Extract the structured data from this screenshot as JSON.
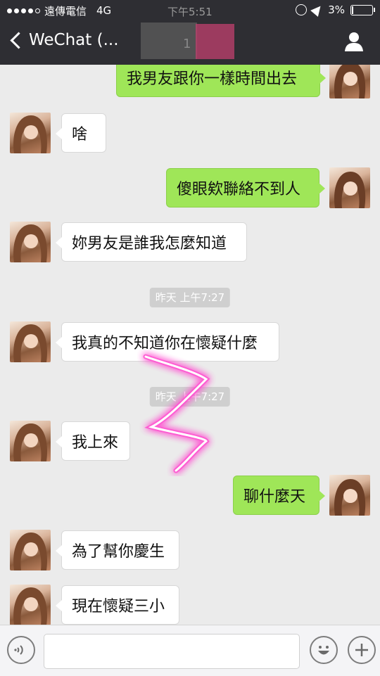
{
  "status": {
    "carrier": "遠傳電信",
    "network": "4G",
    "time": "下午5:51",
    "battery": "3%"
  },
  "nav": {
    "back_label": "WeChat (...",
    "title_hidden": "1"
  },
  "messages": [
    {
      "side": "right",
      "text": "我男友跟你一樣時間出去"
    },
    {
      "side": "left",
      "text": "啥"
    },
    {
      "side": "right",
      "text": "傻眼欸聯絡不到人"
    },
    {
      "side": "left",
      "text": "妳男友是誰我怎麼知道"
    },
    {
      "type": "time",
      "text": "昨天 上午7:27"
    },
    {
      "side": "left",
      "text": "我真的不知道你在懷疑什麼"
    },
    {
      "type": "time",
      "text": "昨天 上午7:27"
    },
    {
      "side": "left",
      "text": "我上來"
    },
    {
      "side": "right",
      "text": "聊什麼天"
    },
    {
      "side": "left",
      "text": "為了幫你慶生"
    },
    {
      "side": "left",
      "text": "現在懷疑三小"
    }
  ],
  "input": {
    "placeholder": ""
  },
  "colors": {
    "header": "#2e2e33",
    "sent_bubble": "#9fe658",
    "received_bubble": "#ffffff",
    "background": "#ebebeb"
  },
  "icons": {
    "back": "chevron-left-icon",
    "contact": "person-icon",
    "voice": "voice-icon",
    "emoji": "emoji-icon",
    "plus": "plus-icon"
  }
}
